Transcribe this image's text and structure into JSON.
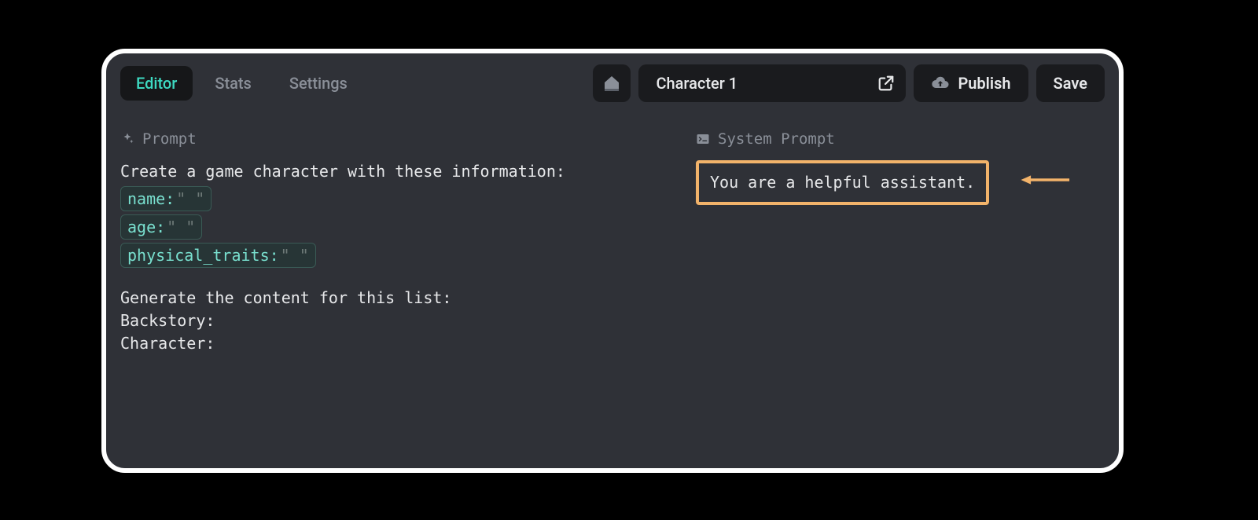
{
  "tabs": {
    "editor": "Editor",
    "stats": "Stats",
    "settings": "Settings"
  },
  "doc": {
    "title": "Character 1"
  },
  "actions": {
    "publish": "Publish",
    "save": "Save"
  },
  "left": {
    "label": "Prompt",
    "line1": "Create a game character with these information:",
    "chips": [
      {
        "key": "name:",
        "val": "\" \""
      },
      {
        "key": "age:",
        "val": "\" \""
      },
      {
        "key": "physical_traits:",
        "val": "\" \""
      }
    ],
    "line2": "Generate the content for this list:",
    "line3": "Backstory:",
    "line4": "Character:"
  },
  "right": {
    "label": "System Prompt",
    "text": "You are a helpful assistant."
  }
}
